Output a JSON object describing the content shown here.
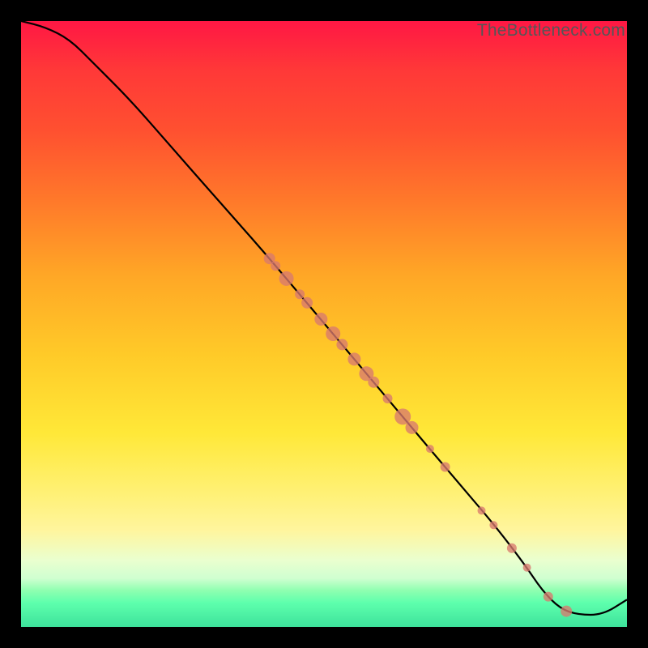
{
  "watermark": "TheBottleneck.com",
  "chart_data": {
    "type": "line",
    "title": "",
    "xlabel": "",
    "ylabel": "",
    "xlim": [
      0,
      100
    ],
    "ylim": [
      0,
      100
    ],
    "background_gradient": [
      "#ff1744",
      "#ffca28",
      "#fff176",
      "#3de29b"
    ],
    "series": [
      {
        "name": "bottleneck-curve",
        "x": [
          0,
          4,
          8,
          12,
          18,
          25,
          32,
          40,
          48,
          56,
          64,
          72,
          78,
          83,
          86,
          89,
          92,
          96,
          100
        ],
        "y": [
          100,
          99,
          97,
          93,
          87,
          79,
          71,
          62,
          52.5,
          43,
          33.5,
          24,
          17,
          10.5,
          6,
          3,
          2,
          2,
          4.5
        ],
        "color": "#000000"
      }
    ],
    "scatter_points": {
      "name": "marked-points",
      "color": "#d87a6e",
      "points": [
        {
          "x": 41.0,
          "y": 60.8,
          "r": 7
        },
        {
          "x": 42.0,
          "y": 59.6,
          "r": 6
        },
        {
          "x": 43.8,
          "y": 57.5,
          "r": 9
        },
        {
          "x": 46.0,
          "y": 54.9,
          "r": 6
        },
        {
          "x": 47.2,
          "y": 53.5,
          "r": 7
        },
        {
          "x": 49.5,
          "y": 50.8,
          "r": 8
        },
        {
          "x": 51.5,
          "y": 48.4,
          "r": 9
        },
        {
          "x": 53.0,
          "y": 46.6,
          "r": 7
        },
        {
          "x": 55.0,
          "y": 44.2,
          "r": 8
        },
        {
          "x": 57.0,
          "y": 41.8,
          "r": 9
        },
        {
          "x": 58.2,
          "y": 40.4,
          "r": 7
        },
        {
          "x": 60.5,
          "y": 37.7,
          "r": 6
        },
        {
          "x": 63.0,
          "y": 34.7,
          "r": 10
        },
        {
          "x": 64.5,
          "y": 32.9,
          "r": 8
        },
        {
          "x": 67.5,
          "y": 29.4,
          "r": 5
        },
        {
          "x": 70.0,
          "y": 26.4,
          "r": 6
        },
        {
          "x": 76.0,
          "y": 19.2,
          "r": 5
        },
        {
          "x": 78.0,
          "y": 16.8,
          "r": 5
        },
        {
          "x": 81.0,
          "y": 13.0,
          "r": 6
        },
        {
          "x": 83.5,
          "y": 9.8,
          "r": 5
        },
        {
          "x": 87.0,
          "y": 5.0,
          "r": 6
        },
        {
          "x": 90.0,
          "y": 2.6,
          "r": 7
        }
      ]
    }
  }
}
